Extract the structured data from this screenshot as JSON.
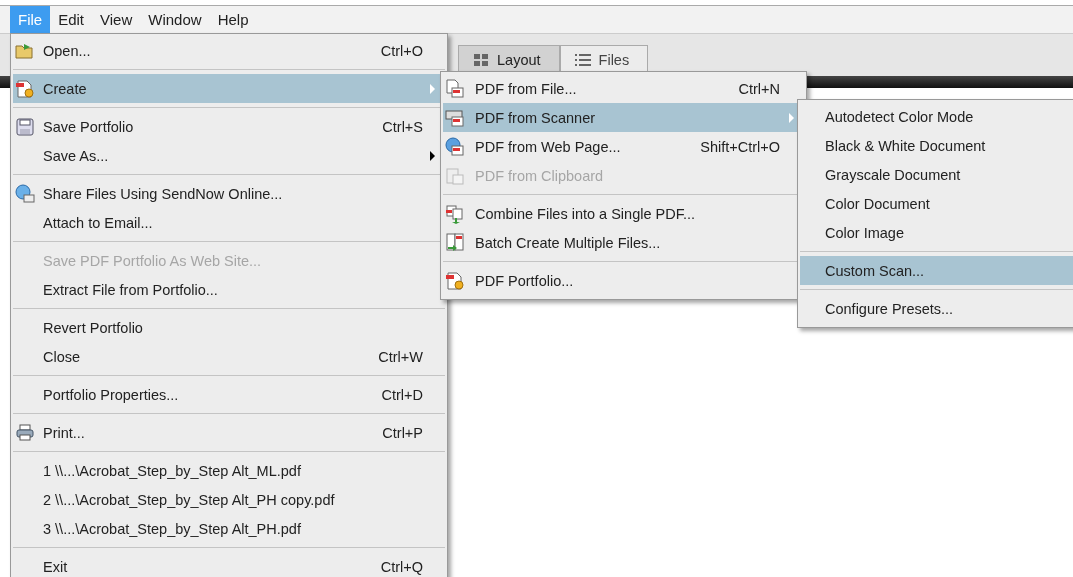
{
  "menu_bar": [
    {
      "label": "File",
      "selected": true
    },
    {
      "label": "Edit",
      "selected": false
    },
    {
      "label": "View",
      "selected": false
    },
    {
      "label": "Window",
      "selected": false
    },
    {
      "label": "Help",
      "selected": false
    }
  ],
  "tabs": [
    {
      "label": "Layout",
      "kind": "grid",
      "selected": true
    },
    {
      "label": "Files",
      "kind": "list",
      "selected": false
    }
  ],
  "menus": [
    {
      "groups": [
        [
          {
            "label": "Open...",
            "shortcut": "Ctrl+O",
            "kind": "folder",
            "submenu": false,
            "selected": false,
            "disabled": false
          }
        ],
        [
          {
            "label": "Create",
            "kind": "create",
            "submenu": true,
            "selected": true,
            "disabled": false
          }
        ],
        [
          {
            "label": "Save Portfolio",
            "shortcut": "Ctrl+S",
            "kind": "save",
            "submenu": false,
            "selected": false,
            "disabled": false
          },
          {
            "label": "Save As...",
            "submenu": true,
            "selected": false,
            "disabled": false
          }
        ],
        [
          {
            "label": "Share Files Using SendNow Online...",
            "kind": "share",
            "submenu": false,
            "selected": false,
            "disabled": false
          },
          {
            "label": "Attach to Email...",
            "submenu": false,
            "selected": false,
            "disabled": false
          }
        ],
        [
          {
            "label": "Save PDF Portfolio As Web Site...",
            "submenu": false,
            "selected": false,
            "disabled": true
          },
          {
            "label": "Extract File from Portfolio...",
            "submenu": false,
            "selected": false,
            "disabled": false
          }
        ],
        [
          {
            "label": "Revert Portfolio",
            "submenu": false,
            "selected": false,
            "disabled": false
          },
          {
            "label": "Close",
            "shortcut": "Ctrl+W",
            "submenu": false,
            "selected": false,
            "disabled": false
          }
        ],
        [
          {
            "label": "Portfolio Properties...",
            "shortcut": "Ctrl+D",
            "submenu": false,
            "selected": false,
            "disabled": false
          }
        ],
        [
          {
            "label": "Print...",
            "shortcut": "Ctrl+P",
            "kind": "print",
            "submenu": false,
            "selected": false,
            "disabled": false
          }
        ],
        [
          {
            "label": "1 \\\\...\\Acrobat_Step_by_Step Alt_ML.pdf",
            "submenu": false,
            "selected": false,
            "disabled": false
          },
          {
            "label": "2 \\\\...\\Acrobat_Step_by_Step Alt_PH copy.pdf",
            "submenu": false,
            "selected": false,
            "disabled": false
          },
          {
            "label": "3 \\\\...\\Acrobat_Step_by_Step Alt_PH.pdf",
            "submenu": false,
            "selected": false,
            "disabled": false
          }
        ],
        [
          {
            "label": "Exit",
            "shortcut": "Ctrl+Q",
            "submenu": false,
            "selected": false,
            "disabled": false
          }
        ]
      ]
    },
    {
      "groups": [
        [
          {
            "label": "PDF from File...",
            "shortcut": "Ctrl+N",
            "kind": "file",
            "submenu": false,
            "selected": false,
            "disabled": false
          },
          {
            "label": "PDF from Scanner",
            "kind": "scanner",
            "submenu": true,
            "selected": true,
            "disabled": false
          },
          {
            "label": "PDF from Web Page...",
            "shortcut": "Shift+Ctrl+O",
            "kind": "web",
            "submenu": false,
            "selected": false,
            "disabled": false
          },
          {
            "label": "PDF from Clipboard",
            "kind": "clipboard",
            "submenu": false,
            "selected": false,
            "disabled": true
          }
        ],
        [
          {
            "label": "Combine Files into a Single PDF...",
            "kind": "combine",
            "submenu": false,
            "selected": false,
            "disabled": false
          },
          {
            "label": "Batch Create Multiple Files...",
            "kind": "batch",
            "submenu": false,
            "selected": false,
            "disabled": false
          }
        ],
        [
          {
            "label": "PDF Portfolio...",
            "kind": "create",
            "submenu": false,
            "selected": false,
            "disabled": false
          }
        ]
      ]
    },
    {
      "groups": [
        [
          {
            "label": "Autodetect Color Mode",
            "submenu": false,
            "selected": false,
            "disabled": false
          },
          {
            "label": "Black & White Document",
            "submenu": false,
            "selected": false,
            "disabled": false
          },
          {
            "label": "Grayscale Document",
            "submenu": false,
            "selected": false,
            "disabled": false
          },
          {
            "label": "Color Document",
            "submenu": false,
            "selected": false,
            "disabled": false
          },
          {
            "label": "Color Image",
            "submenu": false,
            "selected": false,
            "disabled": false
          }
        ],
        [
          {
            "label": "Custom Scan...",
            "submenu": false,
            "selected": true,
            "disabled": false
          }
        ],
        [
          {
            "label": "Configure Presets...",
            "submenu": false,
            "selected": false,
            "disabled": false
          }
        ]
      ]
    }
  ]
}
